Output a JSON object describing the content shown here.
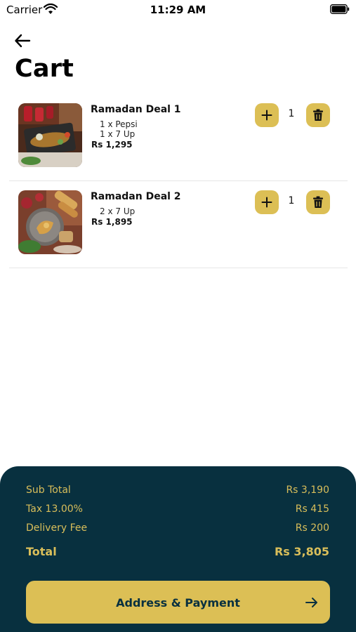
{
  "status_bar": {
    "carrier": "Carrier",
    "time": "11:29 AM"
  },
  "header": {
    "back_icon": "arrow-left-icon",
    "title": "Cart"
  },
  "cart": {
    "items": [
      {
        "name": "Ramadan Deal 1",
        "addons": [
          "1 x Pepsi",
          "1 x 7 Up"
        ],
        "price": "Rs 1,295",
        "quantity": "1"
      },
      {
        "name": "Ramadan Deal 2",
        "addons": [
          "2 x 7 Up"
        ],
        "price": "Rs 1,895",
        "quantity": "1"
      }
    ]
  },
  "summary": {
    "sub_total_label": "Sub Total",
    "sub_total_value": "Rs 3,190",
    "tax_label": "Tax 13.00%",
    "tax_value": "Rs 415",
    "delivery_label": "Delivery Fee",
    "delivery_value": "Rs 200",
    "total_label": "Total",
    "total_value": "Rs 3,805"
  },
  "cta": {
    "label": "Address & Payment",
    "icon": "arrow-right-icon"
  },
  "colors": {
    "accent": "#dcbf55",
    "panel": "#08303f"
  }
}
